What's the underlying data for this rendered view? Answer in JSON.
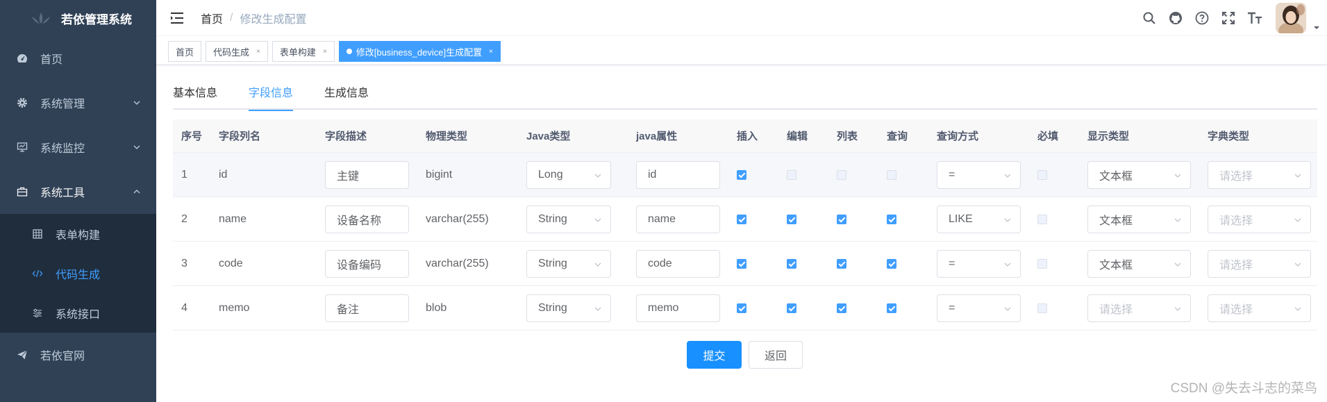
{
  "app": {
    "title": "若依管理系统"
  },
  "sidebar": {
    "items": [
      {
        "label": "首页",
        "icon": "dashboard-icon"
      },
      {
        "label": "系统管理",
        "icon": "gear-icon"
      },
      {
        "label": "系统监控",
        "icon": "monitor-icon"
      },
      {
        "label": "系统工具",
        "icon": "toolbox-icon"
      }
    ],
    "sub_items": [
      {
        "label": "表单构建",
        "icon": "grid-icon"
      },
      {
        "label": "代码生成",
        "icon": "code-icon"
      },
      {
        "label": "系统接口",
        "icon": "sliders-icon"
      }
    ],
    "external": {
      "label": "若依官网",
      "icon": "send-icon"
    }
  },
  "breadcrumb": {
    "home": "首页",
    "separator": "/",
    "current": "修改生成配置"
  },
  "tags": [
    {
      "label": "首页",
      "close": ""
    },
    {
      "label": "代码生成",
      "close": "×"
    },
    {
      "label": "表单构建",
      "close": "×"
    },
    {
      "label": "修改[business_device]生成配置",
      "close": "×"
    }
  ],
  "tabs": [
    "基本信息",
    "字段信息",
    "生成信息"
  ],
  "table": {
    "headers": [
      "序号",
      "字段列名",
      "字段描述",
      "物理类型",
      "Java类型",
      "java属性",
      "插入",
      "编辑",
      "列表",
      "查询",
      "查询方式",
      "必填",
      "显示类型",
      "字典类型"
    ],
    "rows": [
      {
        "index": "1",
        "column": "id",
        "desc": "主键",
        "phys": "bigint",
        "java_type": "Long",
        "java_field": "id",
        "insert": true,
        "edit": false,
        "list": false,
        "query": false,
        "query_type": "=",
        "required": false,
        "html_type": "文本框",
        "dict": "请选择"
      },
      {
        "index": "2",
        "column": "name",
        "desc": "设备名称",
        "phys": "varchar(255)",
        "java_type": "String",
        "java_field": "name",
        "insert": true,
        "edit": true,
        "list": true,
        "query": true,
        "query_type": "LIKE",
        "required": false,
        "html_type": "文本框",
        "dict": "请选择"
      },
      {
        "index": "3",
        "column": "code",
        "desc": "设备编码",
        "phys": "varchar(255)",
        "java_type": "String",
        "java_field": "code",
        "insert": true,
        "edit": true,
        "list": true,
        "query": true,
        "query_type": "=",
        "required": false,
        "html_type": "文本框",
        "dict": "请选择"
      },
      {
        "index": "4",
        "column": "memo",
        "desc": "备注",
        "phys": "blob",
        "java_type": "String",
        "java_field": "memo",
        "insert": true,
        "edit": true,
        "list": true,
        "query": true,
        "query_type": "=",
        "required": false,
        "html_type": "请选择",
        "dict": "请选择"
      }
    ]
  },
  "buttons": {
    "submit": "提交",
    "back": "返回"
  },
  "watermark": "CSDN @失去斗志的菜鸟",
  "colors": {
    "sidebar_bg": "#304156",
    "submenu_bg": "#1f2d3d",
    "primary": "#409eff",
    "active_tag": "#409eff"
  }
}
